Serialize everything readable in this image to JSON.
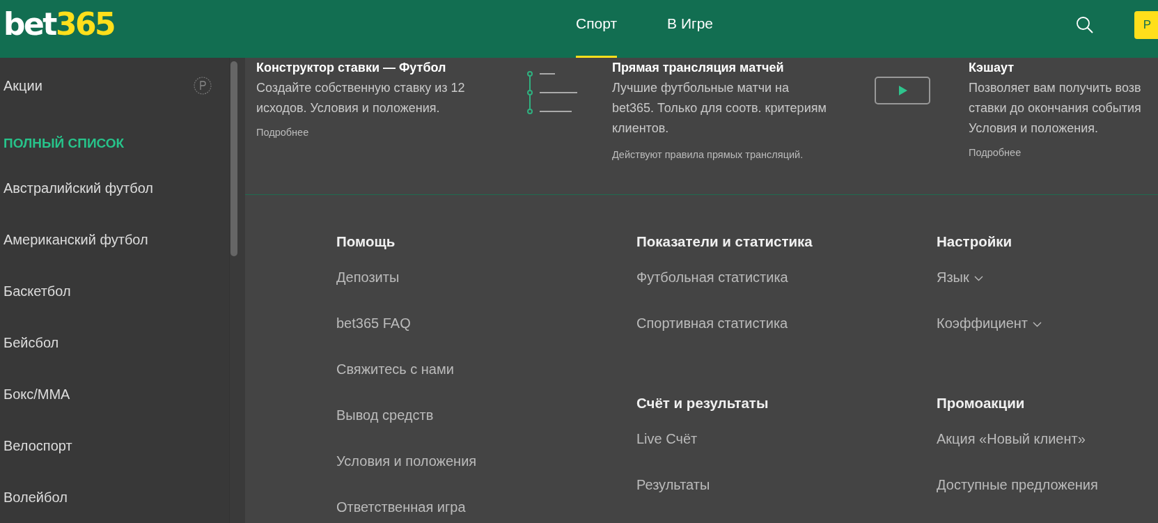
{
  "header": {
    "logo": {
      "part1": "bet",
      "part2": "365"
    },
    "nav": [
      {
        "label": "Спорт",
        "selected": true
      },
      {
        "label": "В Игре",
        "selected": false
      }
    ],
    "action_button": "Р"
  },
  "sidebar": {
    "items": [
      {
        "kind": "promo",
        "label": "Акции"
      },
      {
        "kind": "heading",
        "label": "ПОЛНЫЙ СПИСОК"
      },
      {
        "kind": "sport",
        "label": "Австралийский футбол"
      },
      {
        "kind": "sport",
        "label": "Американский футбол"
      },
      {
        "kind": "sport",
        "label": "Баскетбол"
      },
      {
        "kind": "sport",
        "label": "Бейсбол"
      },
      {
        "kind": "sport",
        "label": "Бокс/MMA"
      },
      {
        "kind": "sport",
        "label": "Велоспорт"
      },
      {
        "kind": "sport",
        "label": "Волейбол"
      }
    ]
  },
  "promos": [
    {
      "kind": "builder",
      "title": "Конструктор ставки — Футбол",
      "lines": [
        "Создайте собственную ставку из 12",
        "исходов. Условия и положения."
      ],
      "link": "Подробнее"
    },
    {
      "kind": "stream",
      "title": "Прямая трансляция матчей",
      "lines": [
        "Лучшие футбольные матчи на",
        "bet365. Только для соотв. критериям",
        "клиентов."
      ],
      "note": "Действуют правила прямых трансляций."
    },
    {
      "title": "Кэшаут",
      "lines": [
        "Позволяет вам получить возв",
        "ставки до окончания события",
        "Условия и положения."
      ],
      "link": "Подробнее"
    }
  ],
  "footer": {
    "columns": [
      {
        "sections": [
          {
            "heading": "Помощь",
            "links": [
              {
                "label": "Депозиты",
                "dropdown": false
              },
              {
                "label": "bet365 FAQ",
                "dropdown": false
              },
              {
                "label": "Свяжитесь с нами",
                "dropdown": false
              },
              {
                "label": "Вывод средств",
                "dropdown": false
              },
              {
                "label": "Условия и положения",
                "dropdown": false
              },
              {
                "label": "Ответственная игра",
                "dropdown": false
              }
            ]
          }
        ]
      },
      {
        "sections": [
          {
            "heading": "Показатели и статистика",
            "links": [
              {
                "label": "Футбольная статистика",
                "dropdown": false
              },
              {
                "label": "Спортивная статистика",
                "dropdown": false
              }
            ]
          },
          {
            "heading": "Счёт и результаты",
            "links": [
              {
                "label": "Live Счёт",
                "dropdown": false
              },
              {
                "label": "Результаты",
                "dropdown": false
              }
            ]
          }
        ]
      },
      {
        "sections": [
          {
            "heading": "Настройки",
            "links": [
              {
                "label": "Язык",
                "dropdown": true
              },
              {
                "label": "Коэффициент",
                "dropdown": true
              }
            ]
          },
          {
            "heading": "Промоакции",
            "links": [
              {
                "label": "Акция «Новый клиент»",
                "dropdown": false
              },
              {
                "label": "Доступные предложения",
                "dropdown": false
              }
            ]
          }
        ]
      }
    ]
  }
}
